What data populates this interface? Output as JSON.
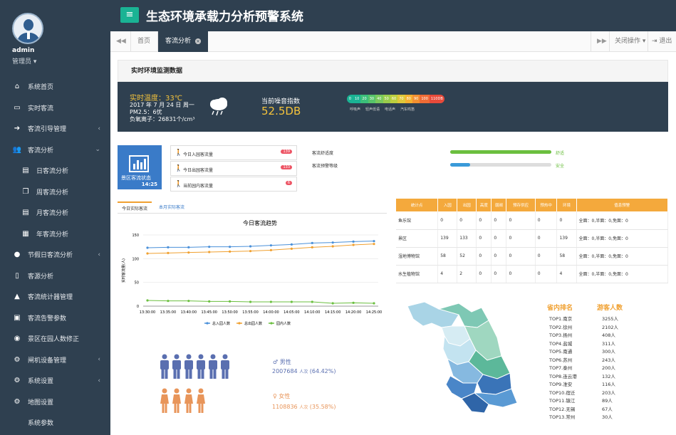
{
  "user": {
    "name": "admin",
    "role": "管理员 ▾"
  },
  "app_title": "生态环境承载力分析预警系统",
  "sidebar": {
    "items": [
      {
        "label": "系统首页",
        "icon": "home-icon",
        "chev": ""
      },
      {
        "label": "实时客流",
        "icon": "monitor-icon",
        "chev": ""
      },
      {
        "label": "客流引导管理",
        "icon": "signin-icon",
        "chev": "‹"
      },
      {
        "label": "客流分析",
        "icon": "users-icon",
        "chev": "⌄"
      },
      {
        "label": "日客流分析",
        "icon": "file-icon",
        "chev": ""
      },
      {
        "label": "周客流分析",
        "icon": "files-icon",
        "chev": ""
      },
      {
        "label": "月客流分析",
        "icon": "file-icon",
        "chev": ""
      },
      {
        "label": "年客流分析",
        "icon": "file-text-icon",
        "chev": ""
      },
      {
        "label": "节假日客流分析",
        "icon": "user-icon",
        "chev": "‹"
      },
      {
        "label": "客源分析",
        "icon": "tablet-icon",
        "chev": ""
      },
      {
        "label": "客流统计器管理",
        "icon": "bell-icon",
        "chev": ""
      },
      {
        "label": "客流告警参数",
        "icon": "briefcase-icon",
        "chev": ""
      },
      {
        "label": "景区在园人数修正",
        "icon": "eye-icon",
        "chev": ""
      },
      {
        "label": "闸机设备管理",
        "icon": "cogs-icon",
        "chev": "‹"
      },
      {
        "label": "系统设置",
        "icon": "cogs-icon",
        "chev": "‹"
      },
      {
        "label": "地图设置",
        "icon": "cogs-icon",
        "chev": ""
      },
      {
        "label": "系统参数",
        "icon": "",
        "chev": ""
      }
    ]
  },
  "tabs": {
    "home": "首页",
    "active": "客流分析",
    "close_ops": "关闭操作 ▾",
    "exit": "退出"
  },
  "monitor": {
    "title": "实时环境监测数据",
    "temp": "实时温度：33℃",
    "date": "2017 年 7 月 24 日 周一",
    "pm": "PM2.5：6优",
    "ion": "负氧离子：26831个/cm³",
    "noise_label": "当前噪音指数",
    "noise_value": "52.5DB",
    "scale": [
      "0",
      "10",
      "20",
      "30",
      "40",
      "50",
      "60",
      "70",
      "80",
      "90",
      "100",
      "110DB"
    ],
    "scale_labels": [
      "呼吸声",
      "轻声低语",
      "电话声",
      "汽车鸣笛"
    ]
  },
  "status": {
    "title": "景区客流状态",
    "time": "14:25",
    "rows": [
      {
        "label": "今日入园客流量",
        "badge": "139"
      },
      {
        "label": "今日出园客流量",
        "badge": "133"
      },
      {
        "label": "当前园内客流量",
        "badge": "6"
      }
    ],
    "comfort_label": "客流舒适度",
    "comfort_value": "舒适",
    "warning_label": "客流预警等级",
    "warning_value": "安全",
    "comfort_level": 1.0,
    "warning_level": 0.2
  },
  "chart_tabs": {
    "today": "今日实际客流",
    "month": "本月实际客流"
  },
  "chart_data": {
    "type": "line",
    "title": "今日客流趋势",
    "ylabel": "实时客流量(人)",
    "ylim": [
      0,
      150
    ],
    "yticks": [
      0,
      50,
      100,
      150
    ],
    "categories": [
      "13:30:00",
      "13:35:00",
      "13:40:00",
      "13:45:00",
      "13:50:00",
      "13:55:00",
      "14:00:00",
      "14:05:00",
      "14:10:00",
      "14:15:00",
      "14:20:00",
      "14:25:00"
    ],
    "series": [
      {
        "name": "总入园人数",
        "color": "#4a90d9",
        "values": [
          123,
          124,
          124,
          125,
          125,
          126,
          128,
          130,
          133,
          134,
          136,
          137
        ]
      },
      {
        "name": "总出园人数",
        "color": "#f0a030",
        "values": [
          111,
          112,
          113,
          114,
          115,
          116,
          118,
          121,
          124,
          126,
          129,
          131
        ]
      },
      {
        "name": "园内人数",
        "color": "#6bbf3f",
        "values": [
          12,
          11,
          11,
          10,
          10,
          9,
          9,
          9,
          9,
          6,
          7,
          6
        ]
      }
    ]
  },
  "table": {
    "headers": [
      "统计点",
      "入园",
      "出园",
      "高度",
      "弱阀",
      "预存供应",
      "预热中",
      "环境",
      "值息预警"
    ],
    "rows": [
      [
        "鱼乐馆",
        "0",
        "0",
        "0",
        "0",
        "0",
        "0",
        "0",
        "全面：0,半面：0,免面：0"
      ],
      [
        "景区",
        "139",
        "133",
        "0",
        "0",
        "0",
        "0",
        "139",
        "全面：0,半面：0,免面：0"
      ],
      [
        "湿地博物馆",
        "58",
        "52",
        "0",
        "0",
        "0",
        "0",
        "58",
        "全面：0,半面：0,免面：0"
      ],
      [
        "水生植物馆",
        "4",
        "2",
        "0",
        "0",
        "0",
        "0",
        "4",
        "全面：0,半面：0,免面：0"
      ]
    ]
  },
  "gender": {
    "male_label": "男性",
    "male_count": "2007684",
    "male_unit": "人次",
    "male_pct": "(64.42%)",
    "female_label": "女性",
    "female_count": "1108836",
    "female_unit": "人次",
    "female_pct": "(35.58%)",
    "male_color": "#5a6fb0",
    "female_color": "#e8955a"
  },
  "ranking": {
    "col1": "省内排名",
    "col2": "游客人数",
    "rows": [
      [
        "TOP1.南京",
        "3255人"
      ],
      [
        "TOP2.徐州",
        "2102人"
      ],
      [
        "TOP3.扬州",
        "408人"
      ],
      [
        "TOP4.盐城",
        "311人"
      ],
      [
        "TOP5.南通",
        "300人"
      ],
      [
        "TOP6.苏州",
        "243人"
      ],
      [
        "TOP7.泰州",
        "200人"
      ],
      [
        "TOP8.连云港",
        "132人"
      ],
      [
        "TOP9.淮安",
        "116人"
      ],
      [
        "TOP10.宿迁",
        "203人"
      ],
      [
        "TOP11.镇江",
        "89人"
      ],
      [
        "TOP12.无锡",
        "67人"
      ],
      [
        "TOP13.常州",
        "30人"
      ]
    ]
  }
}
